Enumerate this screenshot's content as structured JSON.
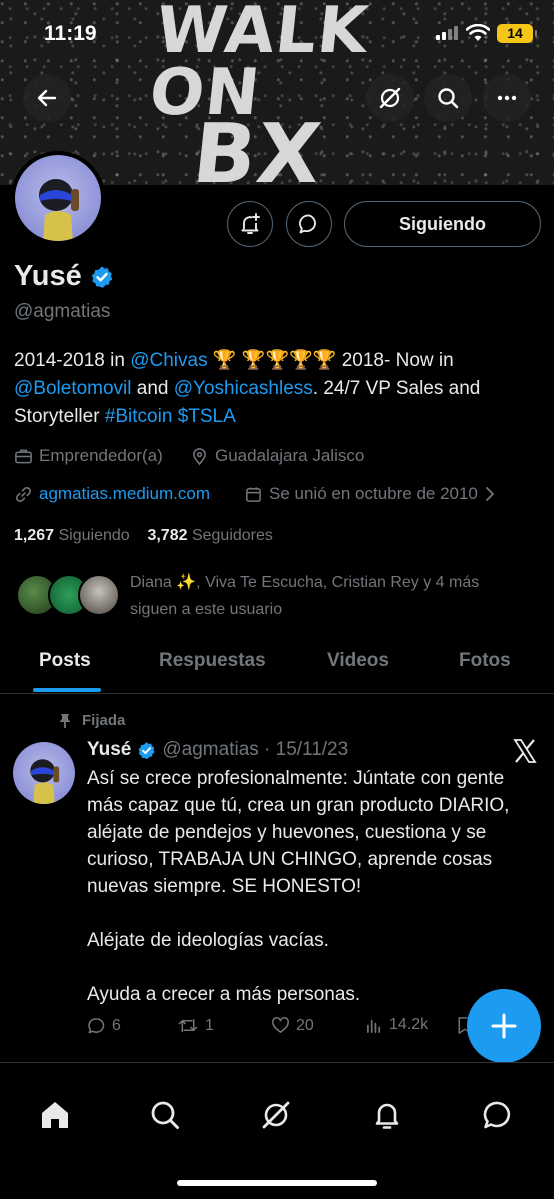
{
  "status_bar": {
    "time": "11:19",
    "battery": "14"
  },
  "banner": {
    "text_line1": "WALK ON",
    "text_line2": "BX"
  },
  "profile": {
    "name": "Yusé",
    "handle": "@agmatias",
    "follow_button": "Siguiendo",
    "bio": {
      "p1": "2014-2018 in ",
      "mention1": "@Chivas",
      "trophies": " 🏆 🏆🏆🏆🏆 ",
      "p2": "2018- Now in ",
      "mention2": "@Boletomovil",
      "p3": " and ",
      "mention3": "@Yoshicashless",
      "p4": ". 24/7 VP Sales and Storyteller ",
      "tag1": "#Bitcoin",
      "p5": " ",
      "tag2": "$TSLA"
    },
    "occupation": "Emprendedor(a)",
    "location": "Guadalajara Jalisco",
    "website": "agmatias.medium.com",
    "joined": "Se unió en octubre de 2010",
    "following_count": "1,267",
    "following_label": "Siguiendo",
    "followers_count": "3,782",
    "followers_label": "Seguidores",
    "followed_by_line1": "Diana ✨, Viva Te Escucha, Cristian Rey y 4 más",
    "followed_by_line2": "siguen a este usuario"
  },
  "tabs": [
    {
      "label": "Posts",
      "active": true
    },
    {
      "label": "Respuestas"
    },
    {
      "label": "Videos"
    },
    {
      "label": "Fotos"
    }
  ],
  "tweet": {
    "pinned_label": "Fijada",
    "name": "Yusé",
    "meta": "@agmatias · 15/11/23",
    "paragraphs": [
      "Así se crece profesionalmente: Júntate con gente más capaz que tú, crea un gran producto DIARIO, aléjate de pendejos y huevones, cuestiona y se curioso, TRABAJA UN CHINGO, aprende cosas nuevas siempre. SE HONESTO!",
      "Aléjate de ideologías vacías.",
      "Ayuda a crecer a más personas."
    ],
    "replies": "6",
    "reposts": "1",
    "likes": "20",
    "views": "14.2k"
  },
  "colors": {
    "accent": "#1d9bf0",
    "muted": "#71767b",
    "text": "#e7e9ea",
    "verified": "#1d9bf0"
  }
}
